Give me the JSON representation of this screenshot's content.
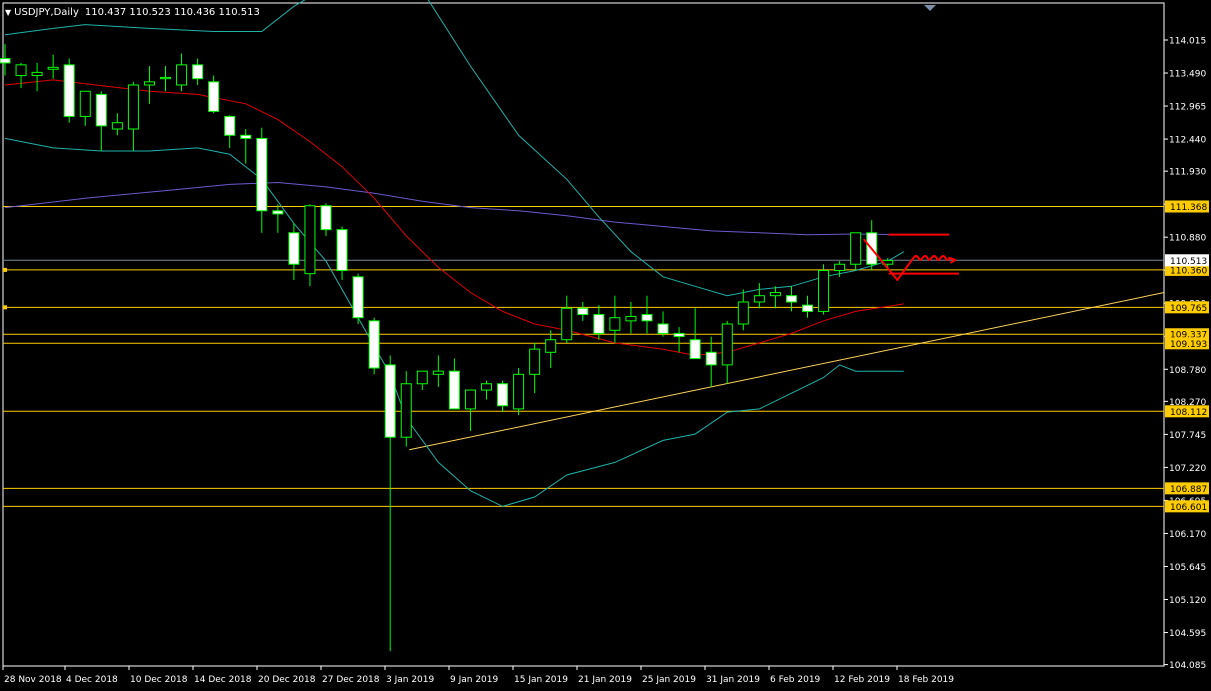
{
  "header": {
    "symbol": "USDJPY,Daily",
    "ohlc": "110.437 110.523 110.436 110.513"
  },
  "colors": {
    "background": "#000000",
    "frame": "#ffffff",
    "bull_body": "#000000",
    "bear_body": "#ffffff",
    "wick": "#00ff00",
    "bollinger": "#20b2aa",
    "ma_mid": "#e00000",
    "ma_long": "#6a5acd",
    "level_line": "#ffcc00",
    "trendline": "#ffd35a",
    "annotation": "#ff0000",
    "current_price_line": "#778899"
  },
  "chart_data": {
    "type": "candlestick",
    "instrument": "USDJPY",
    "timeframe": "Daily",
    "price_axis": {
      "ylim": [
        104.085,
        114.28
      ],
      "ticks": [
        "114.015",
        "113.490",
        "112.965",
        "112.440",
        "111.930",
        "111.405",
        "110.880",
        "110.355",
        "109.830",
        "109.305",
        "108.780",
        "108.270",
        "107.745",
        "107.220",
        "106.695",
        "106.170",
        "105.645",
        "105.120",
        "104.595",
        "104.085"
      ]
    },
    "date_axis": {
      "ticks": [
        "28 Nov 2018",
        "4 Dec 2018",
        "10 Dec 2018",
        "14 Dec 2018",
        "20 Dec 2018",
        "27 Dec 2018",
        "3 Jan 2019",
        "9 Jan 2019",
        "15 Jan 2019",
        "21 Jan 2019",
        "25 Jan 2019",
        "31 Jan 2019",
        "6 Feb 2019",
        "12 Feb 2019",
        "18 Feb 2019"
      ]
    },
    "current_price": {
      "value": 110.513,
      "label": "110.513"
    },
    "levels": [
      {
        "value": 111.368,
        "label": "111.368"
      },
      {
        "value": 110.36,
        "label": "110.360"
      },
      {
        "value": 109.765,
        "label": "109.765"
      },
      {
        "value": 109.337,
        "label": "109.337"
      },
      {
        "value": 109.193,
        "label": "109.193"
      },
      {
        "value": 108.112,
        "label": "108.112"
      },
      {
        "value": 106.887,
        "label": "106.887"
      },
      {
        "value": 106.601,
        "label": "106.601"
      }
    ],
    "candles": [
      {
        "date": "28 Nov 2018",
        "o": 113.72,
        "h": 113.95,
        "l": 113.45,
        "c": 113.65
      },
      {
        "date": "29 Nov 2018",
        "o": 113.45,
        "h": 113.65,
        "l": 113.25,
        "c": 113.62
      },
      {
        "date": "30 Nov 2018",
        "o": 113.45,
        "h": 113.65,
        "l": 113.2,
        "c": 113.5
      },
      {
        "date": "3 Dec 2018",
        "o": 113.55,
        "h": 113.78,
        "l": 113.4,
        "c": 113.58
      },
      {
        "date": "4 Dec 2018",
        "o": 113.62,
        "h": 113.72,
        "l": 112.7,
        "c": 112.8
      },
      {
        "date": "5 Dec 2018",
        "o": 112.8,
        "h": 113.15,
        "l": 112.65,
        "c": 113.2
      },
      {
        "date": "6 Dec 2018",
        "o": 113.15,
        "h": 113.2,
        "l": 112.25,
        "c": 112.65
      },
      {
        "date": "7 Dec 2018",
        "o": 112.6,
        "h": 112.85,
        "l": 112.5,
        "c": 112.7
      },
      {
        "date": "10 Dec 2018",
        "o": 112.6,
        "h": 113.35,
        "l": 112.25,
        "c": 113.3
      },
      {
        "date": "11 Dec 2018",
        "o": 113.3,
        "h": 113.6,
        "l": 113.0,
        "c": 113.35
      },
      {
        "date": "12 Dec 2018",
        "o": 113.4,
        "h": 113.6,
        "l": 113.2,
        "c": 113.42
      },
      {
        "date": "13 Dec 2018",
        "o": 113.3,
        "h": 113.8,
        "l": 113.2,
        "c": 113.62
      },
      {
        "date": "14 Dec 2018",
        "o": 113.62,
        "h": 113.72,
        "l": 113.3,
        "c": 113.4
      },
      {
        "date": "17 Dec 2018",
        "o": 113.35,
        "h": 113.45,
        "l": 112.85,
        "c": 112.88
      },
      {
        "date": "18 Dec 2018",
        "o": 112.8,
        "h": 112.82,
        "l": 112.3,
        "c": 112.5
      },
      {
        "date": "19 Dec 2018",
        "o": 112.5,
        "h": 112.6,
        "l": 112.05,
        "c": 112.45
      },
      {
        "date": "20 Dec 2018",
        "o": 112.45,
        "h": 112.62,
        "l": 110.95,
        "c": 111.3
      },
      {
        "date": "21 Dec 2018",
        "o": 111.3,
        "h": 111.4,
        "l": 110.95,
        "c": 111.25
      },
      {
        "date": "24 Dec 2018",
        "o": 110.95,
        "h": 111.1,
        "l": 110.2,
        "c": 110.45
      },
      {
        "date": "25 Dec 2018",
        "o": 110.3,
        "h": 111.4,
        "l": 110.1,
        "c": 111.38
      },
      {
        "date": "26 Dec 2018",
        "o": 111.38,
        "h": 111.42,
        "l": 110.9,
        "c": 111.0
      },
      {
        "date": "27 Dec 2018",
        "o": 111.0,
        "h": 111.05,
        "l": 110.2,
        "c": 110.35
      },
      {
        "date": "28 Dec 2018",
        "o": 110.25,
        "h": 110.3,
        "l": 109.5,
        "c": 109.6
      },
      {
        "date": "31 Dec 2018",
        "o": 109.55,
        "h": 109.6,
        "l": 108.7,
        "c": 108.8
      },
      {
        "date": "2 Jan 2019",
        "o": 108.85,
        "h": 109.0,
        "l": 104.3,
        "c": 107.7
      },
      {
        "date": "3 Jan 2019",
        "o": 107.7,
        "h": 108.75,
        "l": 107.55,
        "c": 108.55
      },
      {
        "date": "4 Jan 2019",
        "o": 108.55,
        "h": 108.75,
        "l": 108.45,
        "c": 108.75
      },
      {
        "date": "7 Jan 2019",
        "o": 108.7,
        "h": 109.0,
        "l": 108.5,
        "c": 108.75
      },
      {
        "date": "8 Jan 2019",
        "o": 108.75,
        "h": 108.95,
        "l": 108.5,
        "c": 108.15
      },
      {
        "date": "9 Jan 2019",
        "o": 108.15,
        "h": 108.4,
        "l": 107.8,
        "c": 108.45
      },
      {
        "date": "10 Jan 2019",
        "o": 108.45,
        "h": 108.6,
        "l": 108.3,
        "c": 108.55
      },
      {
        "date": "11 Jan 2019",
        "o": 108.55,
        "h": 108.6,
        "l": 108.1,
        "c": 108.2
      },
      {
        "date": "14 Jan 2019",
        "o": 108.15,
        "h": 108.8,
        "l": 108.05,
        "c": 108.7
      },
      {
        "date": "15 Jan 2019",
        "o": 108.7,
        "h": 109.2,
        "l": 108.4,
        "c": 109.1
      },
      {
        "date": "16 Jan 2019",
        "o": 109.05,
        "h": 109.4,
        "l": 108.8,
        "c": 109.25
      },
      {
        "date": "17 Jan 2019",
        "o": 109.25,
        "h": 109.95,
        "l": 109.2,
        "c": 109.75
      },
      {
        "date": "18 Jan 2019",
        "o": 109.75,
        "h": 109.85,
        "l": 109.55,
        "c": 109.65
      },
      {
        "date": "21 Jan 2019",
        "o": 109.65,
        "h": 109.8,
        "l": 109.25,
        "c": 109.35
      },
      {
        "date": "22 Jan 2019",
        "o": 109.4,
        "h": 109.95,
        "l": 109.2,
        "c": 109.6
      },
      {
        "date": "23 Jan 2019",
        "o": 109.55,
        "h": 109.85,
        "l": 109.35,
        "c": 109.62
      },
      {
        "date": "24 Jan 2019",
        "o": 109.65,
        "h": 109.95,
        "l": 109.35,
        "c": 109.55
      },
      {
        "date": "25 Jan 2019",
        "o": 109.5,
        "h": 109.7,
        "l": 109.3,
        "c": 109.35
      },
      {
        "date": "28 Jan 2019",
        "o": 109.35,
        "h": 109.45,
        "l": 109.05,
        "c": 109.3
      },
      {
        "date": "29 Jan 2019",
        "o": 109.25,
        "h": 109.75,
        "l": 108.95,
        "c": 108.95
      },
      {
        "date": "30 Jan 2019",
        "o": 109.05,
        "h": 109.3,
        "l": 108.5,
        "c": 108.85
      },
      {
        "date": "31 Jan 2019",
        "o": 108.85,
        "h": 109.55,
        "l": 108.55,
        "c": 109.5
      },
      {
        "date": "1 Feb 2019",
        "o": 109.5,
        "h": 110.05,
        "l": 109.4,
        "c": 109.85
      },
      {
        "date": "4 Feb 2019",
        "o": 109.85,
        "h": 110.15,
        "l": 109.75,
        "c": 109.95
      },
      {
        "date": "5 Feb 2019",
        "o": 109.95,
        "h": 110.1,
        "l": 109.75,
        "c": 110.0
      },
      {
        "date": "6 Feb 2019",
        "o": 109.95,
        "h": 110.1,
        "l": 109.7,
        "c": 109.85
      },
      {
        "date": "7 Feb 2019",
        "o": 109.8,
        "h": 109.95,
        "l": 109.6,
        "c": 109.7
      },
      {
        "date": "8 Feb 2019",
        "o": 109.7,
        "h": 110.45,
        "l": 109.65,
        "c": 110.35
      },
      {
        "date": "11 Feb 2019",
        "o": 110.35,
        "h": 110.5,
        "l": 110.25,
        "c": 110.45
      },
      {
        "date": "12 Feb 2019",
        "o": 110.45,
        "h": 110.95,
        "l": 110.35,
        "c": 110.95
      },
      {
        "date": "13 Feb 2019",
        "o": 110.95,
        "h": 111.15,
        "l": 110.35,
        "c": 110.45
      },
      {
        "date": "14 Feb 2019",
        "o": 110.45,
        "h": 110.55,
        "l": 110.35,
        "c": 110.51
      }
    ],
    "indicators": {
      "bollinger_upper": [
        [
          0,
          114.1
        ],
        [
          3,
          114.2
        ],
        [
          5,
          114.26
        ],
        [
          9,
          114.2
        ],
        [
          13,
          114.15
        ],
        [
          16,
          114.15
        ],
        [
          18,
          114.55
        ],
        [
          21,
          115.0
        ],
        [
          24,
          115.2
        ],
        [
          26,
          114.8
        ],
        [
          29,
          113.6
        ],
        [
          32,
          112.5
        ],
        [
          35,
          111.8
        ],
        [
          37,
          111.2
        ],
        [
          39,
          110.65
        ],
        [
          41,
          110.25
        ],
        [
          43,
          110.1
        ],
        [
          45,
          109.95
        ],
        [
          47,
          110.05
        ],
        [
          49,
          110.1
        ],
        [
          51,
          110.25
        ],
        [
          53,
          110.35
        ],
        [
          55,
          110.5
        ],
        [
          56,
          110.65
        ]
      ],
      "bollinger_lower": [
        [
          0,
          112.45
        ],
        [
          3,
          112.3
        ],
        [
          6,
          112.25
        ],
        [
          9,
          112.25
        ],
        [
          12,
          112.3
        ],
        [
          14,
          112.2
        ],
        [
          16,
          111.8
        ],
        [
          18,
          111.1
        ],
        [
          20,
          110.5
        ],
        [
          22,
          109.6
        ],
        [
          24,
          108.7
        ],
        [
          25,
          108.0
        ],
        [
          27,
          107.3
        ],
        [
          29,
          106.85
        ],
        [
          31,
          106.6
        ],
        [
          33,
          106.75
        ],
        [
          35,
          107.1
        ],
        [
          38,
          107.3
        ],
        [
          41,
          107.65
        ],
        [
          43,
          107.75
        ],
        [
          45,
          108.1
        ],
        [
          47,
          108.15
        ],
        [
          49,
          108.4
        ],
        [
          51,
          108.65
        ],
        [
          52,
          108.85
        ],
        [
          53,
          108.75
        ],
        [
          56,
          108.75
        ]
      ],
      "ma_mid": [
        [
          0,
          113.3
        ],
        [
          3,
          113.38
        ],
        [
          5,
          113.32
        ],
        [
          9,
          113.2
        ],
        [
          12,
          113.15
        ],
        [
          15,
          113.0
        ],
        [
          17,
          112.75
        ],
        [
          19,
          112.4
        ],
        [
          21,
          112.0
        ],
        [
          23,
          111.5
        ],
        [
          25,
          110.9
        ],
        [
          27,
          110.4
        ],
        [
          29,
          110.0
        ],
        [
          31,
          109.7
        ],
        [
          33,
          109.5
        ],
        [
          35,
          109.4
        ],
        [
          38,
          109.2
        ],
        [
          41,
          109.1
        ],
        [
          43,
          109.0
        ],
        [
          45,
          109.05
        ],
        [
          47,
          109.2
        ],
        [
          49,
          109.35
        ],
        [
          51,
          109.55
        ],
        [
          53,
          109.7
        ],
        [
          56,
          109.82
        ]
      ],
      "ma_long": [
        [
          0,
          111.35
        ],
        [
          5,
          111.5
        ],
        [
          10,
          111.62
        ],
        [
          14,
          111.72
        ],
        [
          17,
          111.75
        ],
        [
          20,
          111.68
        ],
        [
          23,
          111.58
        ],
        [
          26,
          111.45
        ],
        [
          29,
          111.35
        ],
        [
          32,
          111.3
        ],
        [
          35,
          111.22
        ],
        [
          38,
          111.12
        ],
        [
          41,
          111.05
        ],
        [
          44,
          110.98
        ],
        [
          47,
          110.95
        ],
        [
          50,
          110.92
        ],
        [
          53,
          110.93
        ],
        [
          56,
          110.92
        ]
      ]
    },
    "trendline": {
      "from": [
        "3 Jan 2019",
        107.5
      ],
      "to_right_edge_value": 110.0
    },
    "annotation": {
      "resistance": [
        [
          "14 Feb 2019",
          110.92
        ],
        [
          "20 Feb 2019",
          110.92
        ]
      ],
      "support": [
        [
          "14 Feb 2019",
          110.3
        ],
        [
          "20 Feb 2019",
          110.3
        ]
      ],
      "projection": "drop toward 110.20 then sideways near 110.55"
    }
  }
}
